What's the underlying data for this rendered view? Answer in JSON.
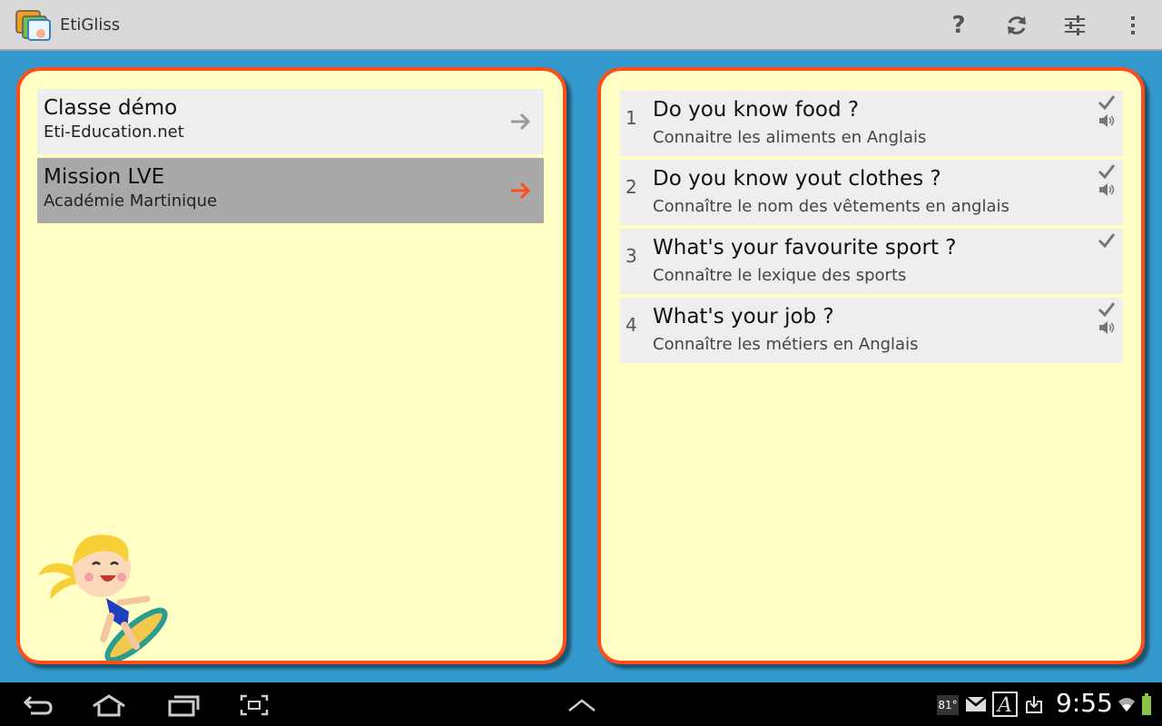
{
  "app": {
    "title": "EtiGliss"
  },
  "actionbar": {
    "icons": [
      "help-icon",
      "refresh-icon",
      "settings-sliders-icon",
      "overflow-menu-icon"
    ],
    "help_label": "?"
  },
  "classes": [
    {
      "name": "Classe démo",
      "subtitle": "Eti-Education.net",
      "selected": false
    },
    {
      "name": "Mission LVE",
      "subtitle": "Académie Martinique",
      "selected": true
    }
  ],
  "missions": [
    {
      "number": "1",
      "title": "Do you know food ?",
      "subtitle": "Connaitre les aliments en Anglais",
      "checked": true,
      "sound": true
    },
    {
      "number": "2",
      "title": "Do you know yout clothes ?",
      "subtitle": "Connaître le nom des vêtements en anglais",
      "checked": true,
      "sound": true
    },
    {
      "number": "3",
      "title": "What's your favourite sport ?",
      "subtitle": "Connaître le lexique des sports",
      "checked": true,
      "sound": false
    },
    {
      "number": "4",
      "title": "What's your job ?",
      "subtitle": "Connaître les métiers en Anglais",
      "checked": true,
      "sound": true
    }
  ],
  "system_bar": {
    "temperature": "81°",
    "time": "9:55",
    "nav_icons": [
      "back-icon",
      "home-icon",
      "recent-apps-icon",
      "screenshot-icon",
      "expand-up-icon"
    ],
    "status_icons": [
      "gmail-icon",
      "font-app-icon",
      "download-icon",
      "wifi-icon",
      "battery-icon"
    ]
  },
  "colors": {
    "background": "#3399cc",
    "panel": "#ffffc6",
    "panel_border": "#ff4d1a",
    "arrow_active": "#ff4d1a",
    "arrow_inactive": "#999999",
    "selected_row": "#a9a9a9"
  }
}
